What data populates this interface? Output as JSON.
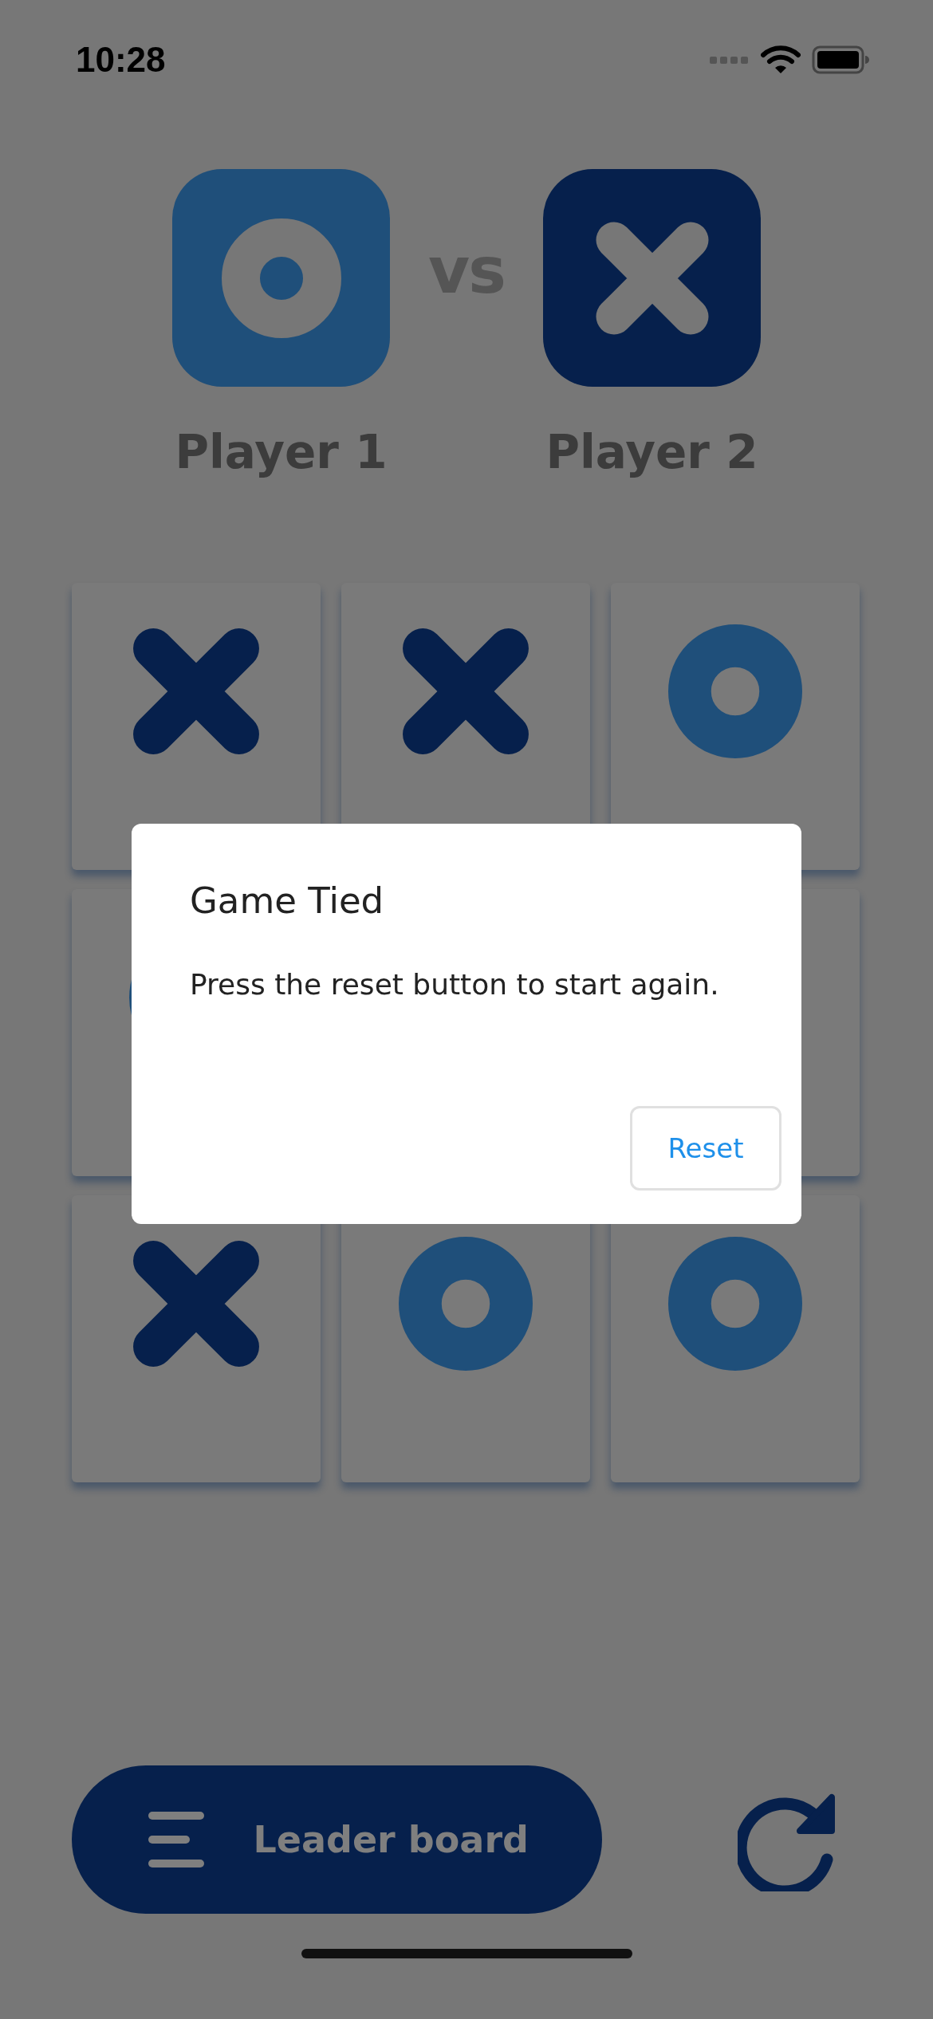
{
  "status_bar": {
    "time": "10:28"
  },
  "players": [
    {
      "name": "Player 1",
      "kind": "o"
    },
    {
      "name": "Player 2",
      "kind": "x"
    }
  ],
  "versus": "vs",
  "board": [
    {
      "kind": "x"
    },
    {
      "kind": "x"
    },
    {
      "kind": "o"
    },
    {
      "kind": "o"
    },
    {
      "kind": "covered"
    },
    {
      "kind": "empty"
    },
    {
      "kind": "x"
    },
    {
      "kind": "o"
    },
    {
      "kind": "o"
    }
  ],
  "dialog": {
    "title": "Game Tied",
    "message": "Press the reset button to start again.",
    "button": "Reset"
  },
  "leaderboard_button": {
    "label": "Leader board"
  }
}
